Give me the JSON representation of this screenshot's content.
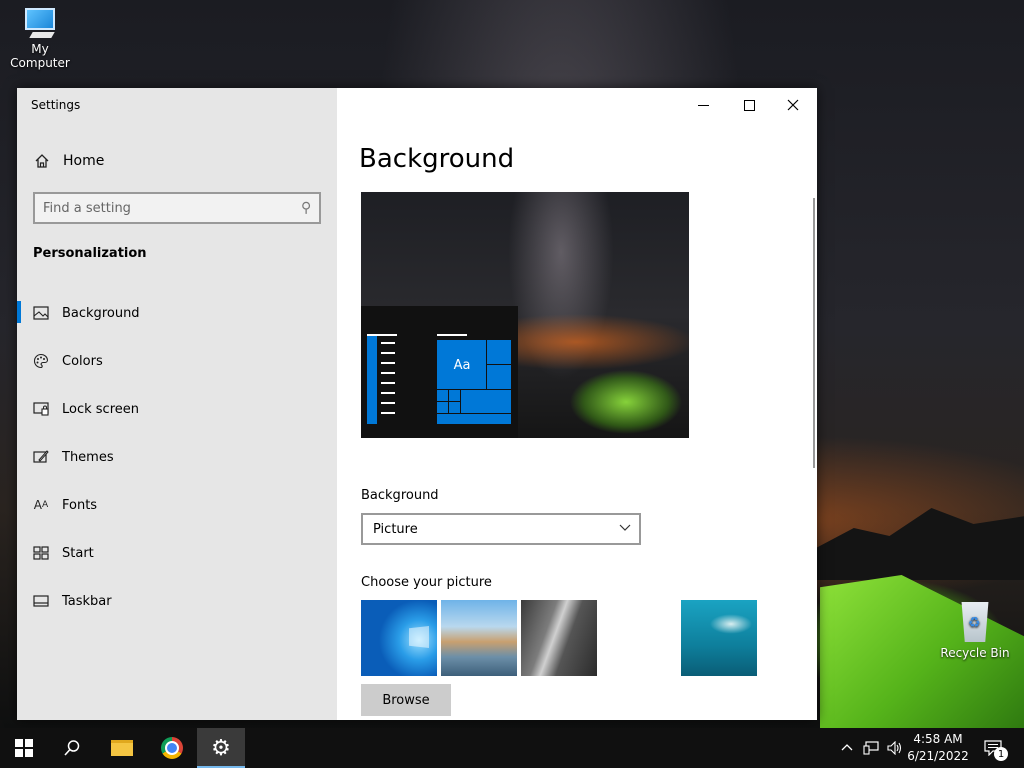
{
  "desktop": {
    "icons": [
      {
        "label": "My Computer",
        "icon": "computer-icon"
      },
      {
        "label": "Recycle Bin",
        "icon": "recycle-bin-icon"
      }
    ]
  },
  "window": {
    "title": "Settings",
    "controls": {
      "minimize": "minimize-icon",
      "maximize": "maximize-icon",
      "close": "close-icon"
    }
  },
  "sidebar": {
    "home_label": "Home",
    "search_placeholder": "Find a setting",
    "section_title": "Personalization",
    "items": [
      {
        "label": "Background",
        "icon": "image-icon",
        "active": true
      },
      {
        "label": "Colors",
        "icon": "palette-icon",
        "active": false
      },
      {
        "label": "Lock screen",
        "icon": "lock-screen-icon",
        "active": false
      },
      {
        "label": "Themes",
        "icon": "themes-icon",
        "active": false
      },
      {
        "label": "Fonts",
        "icon": "fonts-icon",
        "active": false
      },
      {
        "label": "Start",
        "icon": "start-icon",
        "active": false
      },
      {
        "label": "Taskbar",
        "icon": "taskbar-icon",
        "active": false
      }
    ]
  },
  "main": {
    "title": "Background",
    "preview": {
      "tile_label": "Aa"
    },
    "background_label": "Background",
    "background_select_value": "Picture",
    "choose_picture_label": "Choose your picture",
    "browse_label": "Browse"
  },
  "taskbar": {
    "time": "4:58 AM",
    "date": "6/21/2022",
    "notification_count": "1",
    "accent_color": "#76b9ed"
  },
  "colors": {
    "accent": "#0078d7",
    "sidebar_bg": "#e6e6e6"
  }
}
